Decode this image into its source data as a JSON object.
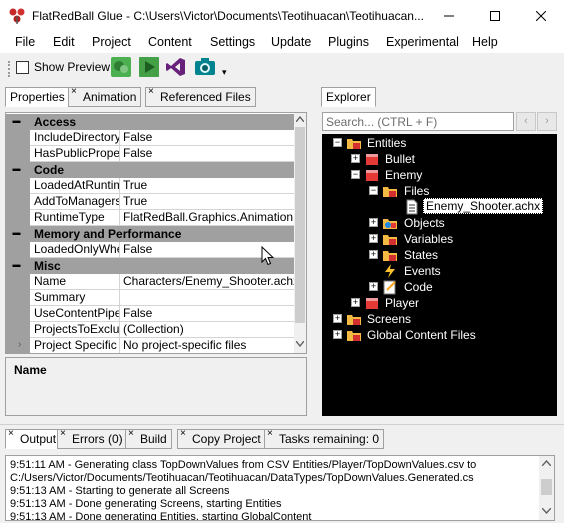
{
  "window": {
    "title": "FlatRedBall Glue - C:\\Users\\Victor\\Documents\\Teotihuacan\\Teotihuacan...",
    "minimize_icon": "minimize-icon",
    "maximize_icon": "maximize-icon",
    "close_icon": "close-icon"
  },
  "menu": [
    "File",
    "Edit",
    "Project",
    "Content",
    "Settings",
    "Update",
    "Plugins",
    "Experimental",
    "Help"
  ],
  "toolbar": {
    "show_preview_label": "Show Preview",
    "show_preview_checked": false,
    "buttons": [
      "build-icon",
      "play-icon",
      "visual-studio-icon",
      "camera-icon"
    ]
  },
  "left_tabs": {
    "properties": "Properties",
    "animation": "Animation",
    "referenced_files": "Referenced Files"
  },
  "properties": {
    "categories": [
      {
        "name": "Access",
        "rows": [
          {
            "name": "IncludeDirectoryR",
            "value": "False"
          },
          {
            "name": "HasPublicPropert",
            "value": "False"
          }
        ]
      },
      {
        "name": "Code",
        "rows": [
          {
            "name": "LoadedAtRuntime",
            "value": "True"
          },
          {
            "name": "AddToManagers",
            "value": "True"
          },
          {
            "name": "RuntimeType",
            "value": "FlatRedBall.Graphics.Animation.Anim"
          }
        ]
      },
      {
        "name": "Memory and Performance",
        "rows": [
          {
            "name": "LoadedOnlyWhe",
            "value": "False"
          }
        ]
      },
      {
        "name": "Misc",
        "rows": [
          {
            "name": "Name",
            "value": "Characters/Enemy_Shooter.achx"
          },
          {
            "name": "Summary",
            "value": ""
          },
          {
            "name": "UseContentPipeli",
            "value": "False"
          },
          {
            "name": "ProjectsToExclud",
            "value": "(Collection)"
          },
          {
            "name": "Project Specific F",
            "value": "No project-specific files"
          }
        ]
      }
    ],
    "description_title": "Name"
  },
  "explorer": {
    "tab": "Explorer",
    "search_placeholder": "Search... (CTRL + F)",
    "tree": {
      "entities": "Entities",
      "bullet": "Bullet",
      "enemy": "Enemy",
      "files": "Files",
      "selected_file": "Enemy_Shooter.achx",
      "objects": "Objects",
      "variables": "Variables",
      "states": "States",
      "events": "Events",
      "code": "Code",
      "player": "Player",
      "screens": "Screens",
      "global_content": "Global Content Files"
    }
  },
  "bottom_tabs": {
    "output": "Output",
    "errors": "Errors (0)",
    "build": "Build",
    "copy_project": "Copy Project",
    "tasks": "Tasks remaining: 0"
  },
  "output_lines": [
    "9:51:11 AM - Generating class TopDownValues from CSV Entities/Player/TopDownValues.csv to",
    "C:/Users/Victor/Documents/Teotihuacan/Teotihuacan/DataTypes/TopDownValues.Generated.cs",
    "9:51:13 AM - Starting to generate all Screens",
    "9:51:13 AM - Done generating Screens, starting Entities",
    "9:51:13 AM - Done generating Entities, starting GlobalContent"
  ],
  "colors": {
    "category_bg": "#a0a0a0",
    "tree_bg": "#000000",
    "window_bg": "#f0f0f0"
  }
}
